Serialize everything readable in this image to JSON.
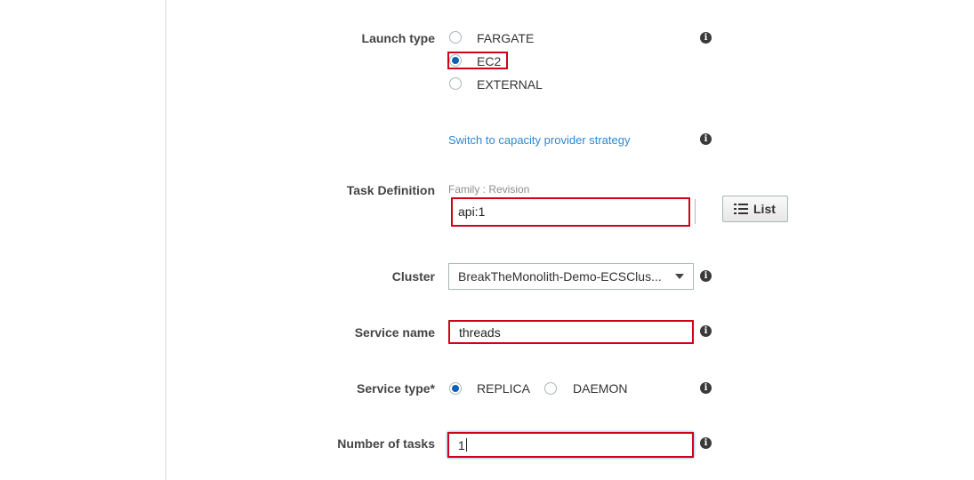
{
  "launch_type": {
    "label": "Launch type",
    "options": [
      "FARGATE",
      "EC2",
      "EXTERNAL"
    ],
    "selected": "EC2",
    "switch_link": "Switch to capacity provider strategy"
  },
  "task_definition": {
    "label": "Task Definition",
    "hint": "Family : Revision",
    "value": "api:1",
    "list_button": "List"
  },
  "cluster": {
    "label": "Cluster",
    "value": "BreakTheMonolith-Demo-ECSClus..."
  },
  "service_name": {
    "label": "Service name",
    "value": "threads"
  },
  "service_type": {
    "label": "Service type*",
    "options": [
      "REPLICA",
      "DAEMON"
    ],
    "selected": "REPLICA"
  },
  "number_of_tasks": {
    "label": "Number of tasks",
    "value": "1"
  },
  "icons": {
    "info": "info-icon",
    "list": "list-icon",
    "dropdown": "chevron-down-icon"
  },
  "colors": {
    "highlight": "#d0021b",
    "link": "#2b88d8",
    "radio_selected": "#0f5fb4"
  }
}
